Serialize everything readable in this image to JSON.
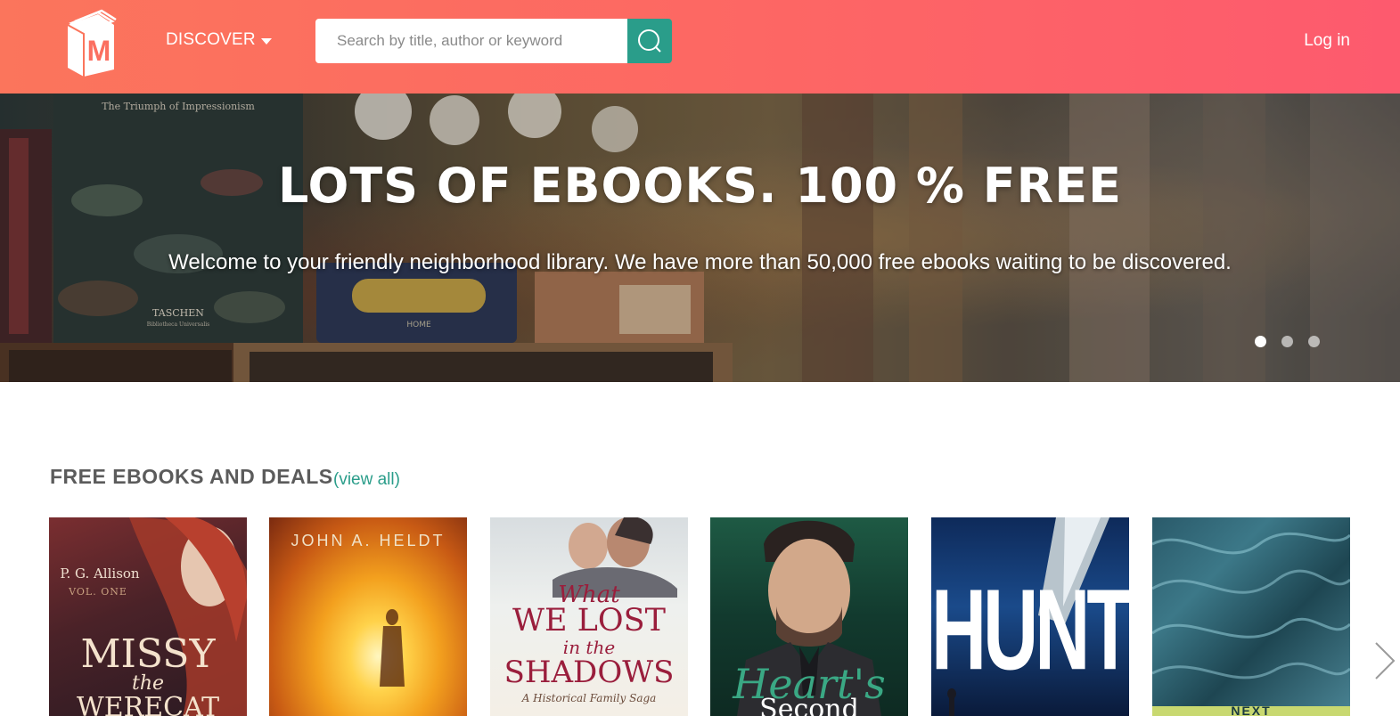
{
  "header": {
    "logo_icon": "library-book-logo",
    "logo_letter": "M",
    "discover_label": "DISCOVER",
    "search": {
      "placeholder": "Search by title, author or keyword",
      "value": ""
    },
    "search_icon": "search-icon",
    "login_label": "Log in",
    "colors": {
      "gradient_start": "#fb755c",
      "gradient_end": "#fd5a6e",
      "accent": "#2a9d8a"
    }
  },
  "hero": {
    "title": "LOTS OF EBOOKS. 100 % FREE",
    "subtitle": "Welcome to your friendly neighborhood library. We have more than 50,000 free ebooks waiting to be discovered.",
    "slides": 3,
    "active_slide": 1,
    "background_text": {
      "book_spine_title": "The Triumph of Impressionism",
      "publisher": "TASCHEN",
      "publisher_sub": "Bibliotheca Universalis",
      "tin_label": "HOME"
    }
  },
  "section": {
    "title": "FREE EBOOKS AND DEALS",
    "view_all_label": "(view all)"
  },
  "books": [
    {
      "author": "P. G. Allison",
      "volume": "VOL. ONE",
      "title_line1": "MISSY",
      "title_line2": "the",
      "title_line3": "WERECAT"
    },
    {
      "author": "JOHN A. HELDT"
    },
    {
      "title_line1": "What",
      "title_line2": "WE LOST",
      "title_line3": "in the",
      "title_line4": "SHADOWS",
      "tagline": "A Historical Family Saga"
    },
    {
      "title_line1": "Heart's",
      "title_line2": "Second"
    },
    {
      "title_line1": "HUNTED"
    },
    {
      "title_line1": "NEXT"
    }
  ],
  "carousel_next_icon": "chevron-right-icon"
}
